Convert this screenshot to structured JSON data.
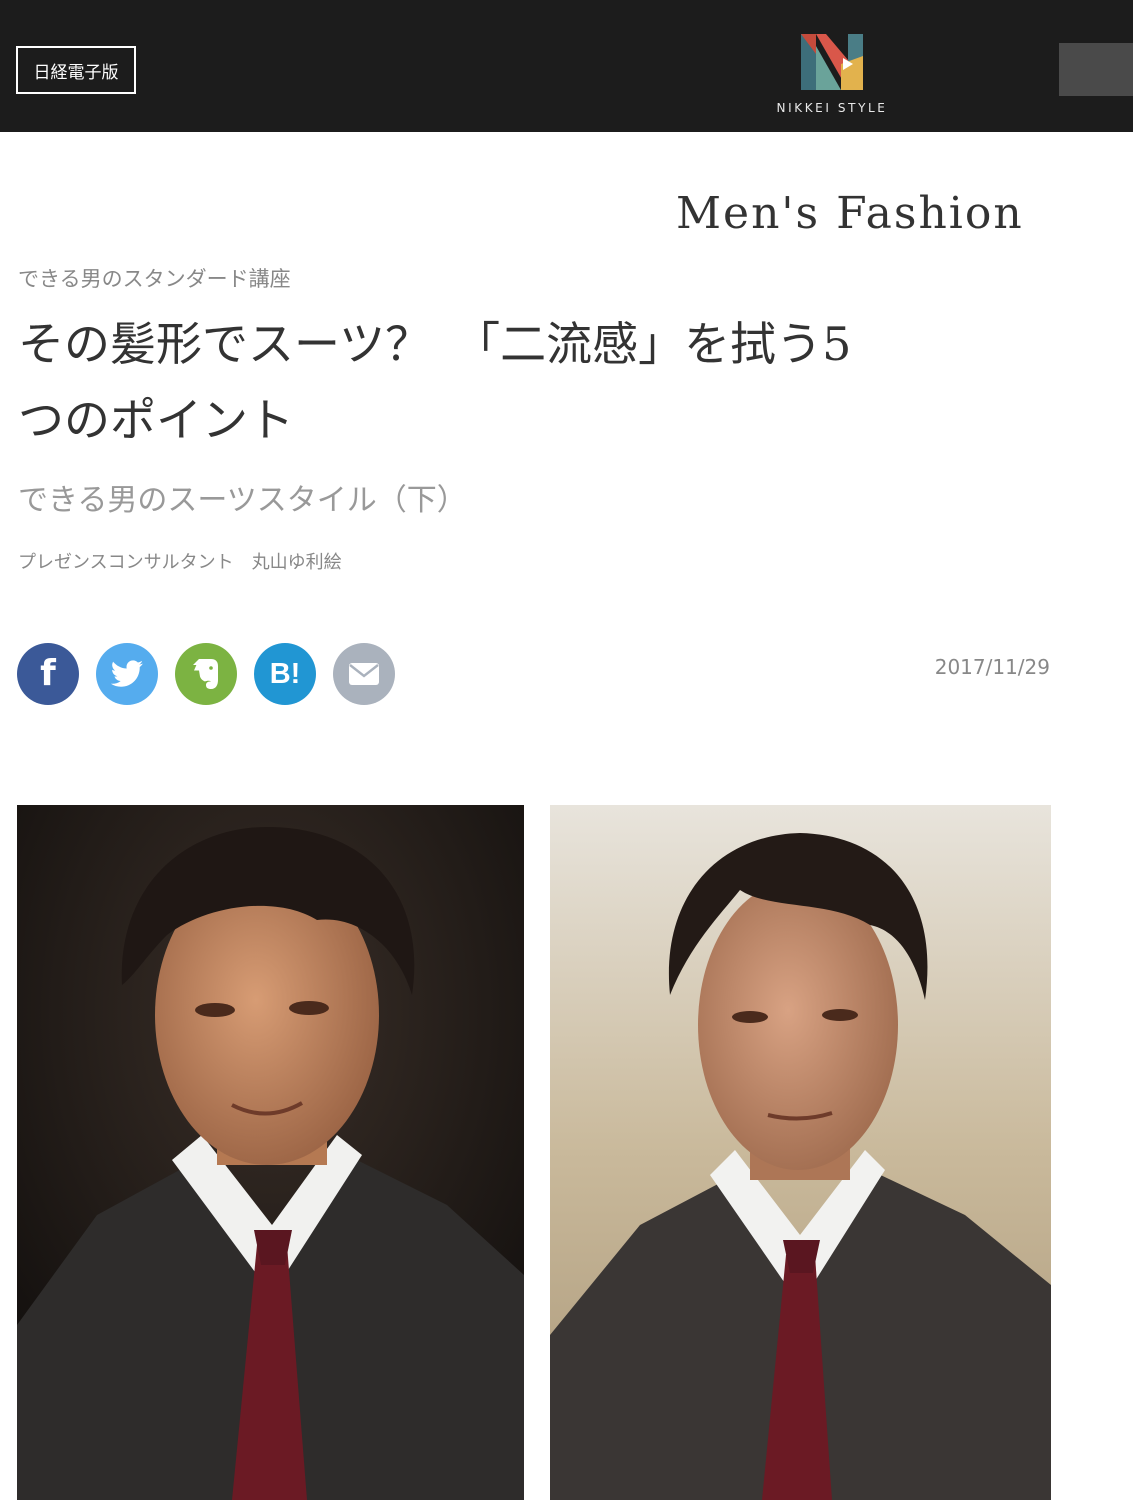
{
  "header": {
    "edition_label": "日経電子版",
    "logo_text": "NIKKEI STYLE"
  },
  "article": {
    "section": "Men's Fashion",
    "series": "できる男のスタンダード講座",
    "title": "その髪形でスーツ？　「二流感」を拭う5\nつのポイント",
    "subtitle": "できる男のスーツスタイル（下）",
    "author": "プレゼンスコンサルタント　丸山ゆ利絵",
    "date": "2017/11/29"
  },
  "share": {
    "icons": [
      "facebook-icon",
      "twitter-icon",
      "evernote-icon",
      "hatena-bookmark-icon",
      "mail-icon"
    ],
    "facebook_glyph": "f",
    "hatena_glyph": "B!",
    "colors": {
      "facebook": "#3b5998",
      "twitter": "#55acee",
      "evernote": "#7cb342",
      "hatena": "#2196d3",
      "mail": "#aab2bd"
    }
  },
  "photos": {
    "colors": {
      "left_background": "#161311",
      "right_background": "#c9b99b"
    }
  }
}
